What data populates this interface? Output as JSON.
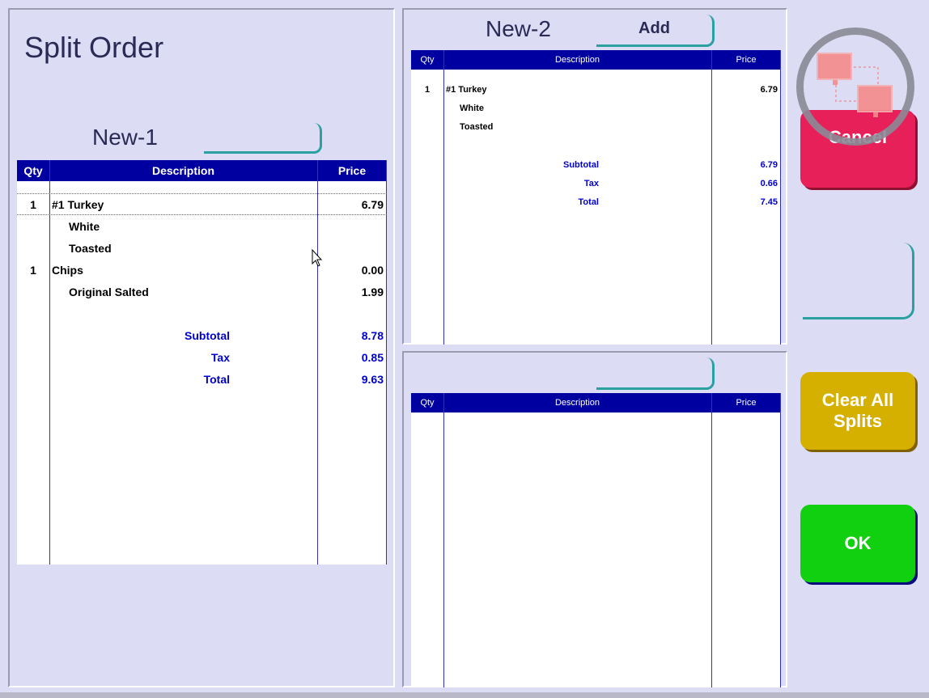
{
  "title": "Split Order",
  "splits": [
    {
      "name": "New-1",
      "button_label": "",
      "columns": {
        "qty": "Qty",
        "description": "Description",
        "price": "Price"
      },
      "items": [
        {
          "qty": "1",
          "desc": "#1 Turkey",
          "price": "6.79",
          "indent": false
        },
        {
          "qty": "",
          "desc": "White",
          "price": "",
          "indent": true
        },
        {
          "qty": "",
          "desc": "Toasted",
          "price": "",
          "indent": true
        },
        {
          "qty": "1",
          "desc": "Chips",
          "price": "0.00",
          "indent": false
        },
        {
          "qty": "",
          "desc": "Original Salted",
          "price": "1.99",
          "indent": true
        }
      ],
      "totals": [
        {
          "label": "Subtotal",
          "value": "8.78"
        },
        {
          "label": "Tax",
          "value": "0.85"
        },
        {
          "label": "Total",
          "value": "9.63"
        }
      ]
    },
    {
      "name": "New-2",
      "button_label": "Add",
      "columns": {
        "qty": "Qty",
        "description": "Description",
        "price": "Price"
      },
      "items": [
        {
          "qty": "1",
          "desc": "#1 Turkey",
          "price": "6.79",
          "indent": false
        },
        {
          "qty": "",
          "desc": "White",
          "price": "",
          "indent": true
        },
        {
          "qty": "",
          "desc": "Toasted",
          "price": "",
          "indent": true
        }
      ],
      "totals": [
        {
          "label": "Subtotal",
          "value": "6.79"
        },
        {
          "label": "Tax",
          "value": "0.66"
        },
        {
          "label": "Total",
          "value": "7.45"
        }
      ]
    },
    {
      "name": "",
      "button_label": "",
      "columns": {
        "qty": "Qty",
        "description": "Description",
        "price": "Price"
      },
      "items": [],
      "totals": []
    }
  ],
  "buttons": {
    "cancel": "Cancel",
    "blank": "",
    "clear_all": "Clear All Splits",
    "ok": "OK"
  },
  "icons": {
    "network": "network-connection-icon",
    "cursor": "mouse-pointer-icon"
  },
  "colors": {
    "header": "#0000a0",
    "cancel": "#e8205a",
    "clear": "#d6b000",
    "ok": "#10d010",
    "totals": "#0000d0"
  }
}
